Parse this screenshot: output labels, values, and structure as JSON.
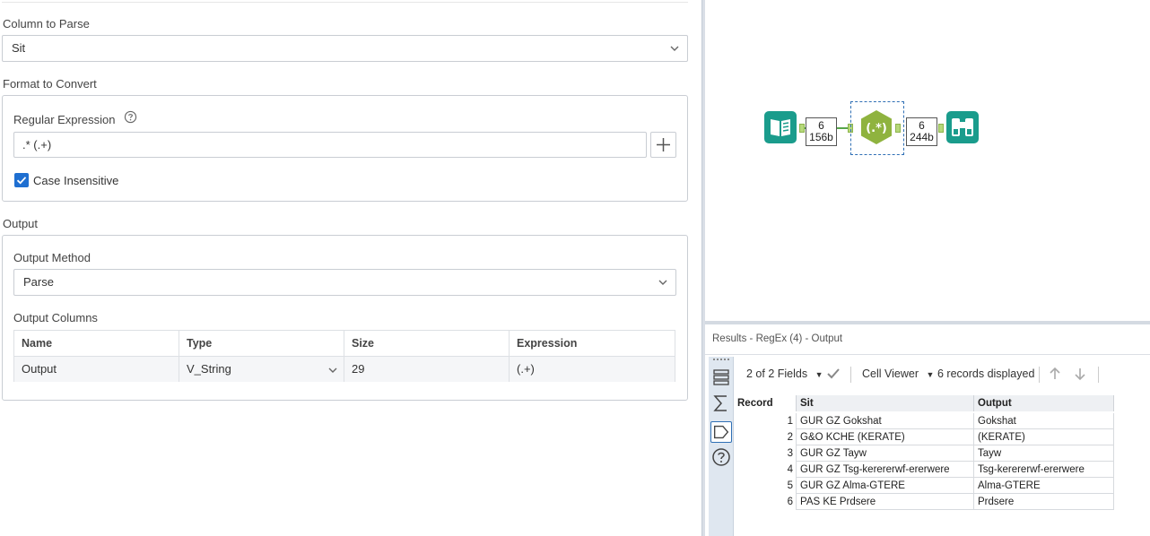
{
  "config": {
    "column_to_parse": {
      "label": "Column to Parse",
      "value": "Sit"
    },
    "format_to_convert": {
      "label": "Format to Convert",
      "regex_label": "Regular Expression",
      "regex_value": ".* (.+)",
      "case_insensitive_label": "Case Insensitive",
      "case_insensitive": true
    },
    "output": {
      "label": "Output",
      "method_label": "Output Method",
      "method_value": "Parse",
      "columns_label": "Output Columns",
      "table": {
        "headers": [
          "Name",
          "Type",
          "Size",
          "Expression"
        ],
        "rows": [
          {
            "name": "Output",
            "type": "V_String",
            "size": "29",
            "expression": "(.+)"
          }
        ]
      }
    }
  },
  "canvas": {
    "badge_in": {
      "count": "6",
      "size": "156b"
    },
    "badge_out": {
      "count": "6",
      "size": "244b"
    },
    "regex_tool_glyph": "(.*)",
    "icons": [
      "input-data-icon",
      "regex-tool-icon",
      "browse-binoculars-icon"
    ],
    "colors": {
      "input": "#1a9c8c",
      "regex": "#8fb33f",
      "browse": "#1a9c8c"
    }
  },
  "results": {
    "title": "Results - RegEx (4) - Output",
    "toolbar": {
      "fields": "2 of 2 Fields",
      "viewer": "Cell Viewer",
      "records": "6 records displayed"
    },
    "headers": [
      "Record",
      "Sit",
      "Output"
    ],
    "rows": [
      {
        "record": "1",
        "sit": "GUR GZ Gokshat",
        "output": "Gokshat"
      },
      {
        "record": "2",
        "sit": "G&O KCHE (KERATE)",
        "output": "(KERATE)"
      },
      {
        "record": "3",
        "sit": "GUR GZ Tayw",
        "output": "Tayw"
      },
      {
        "record": "4",
        "sit": "GUR GZ Tsg-kerererwf-ererwere",
        "output": "Tsg-kerererwf-ererwere"
      },
      {
        "record": "5",
        "sit": "GUR GZ Alma-GTERE",
        "output": "Alma-GTERE"
      },
      {
        "record": "6",
        "sit": "PAS KE Prdsere",
        "output": "Prdsere"
      }
    ]
  }
}
